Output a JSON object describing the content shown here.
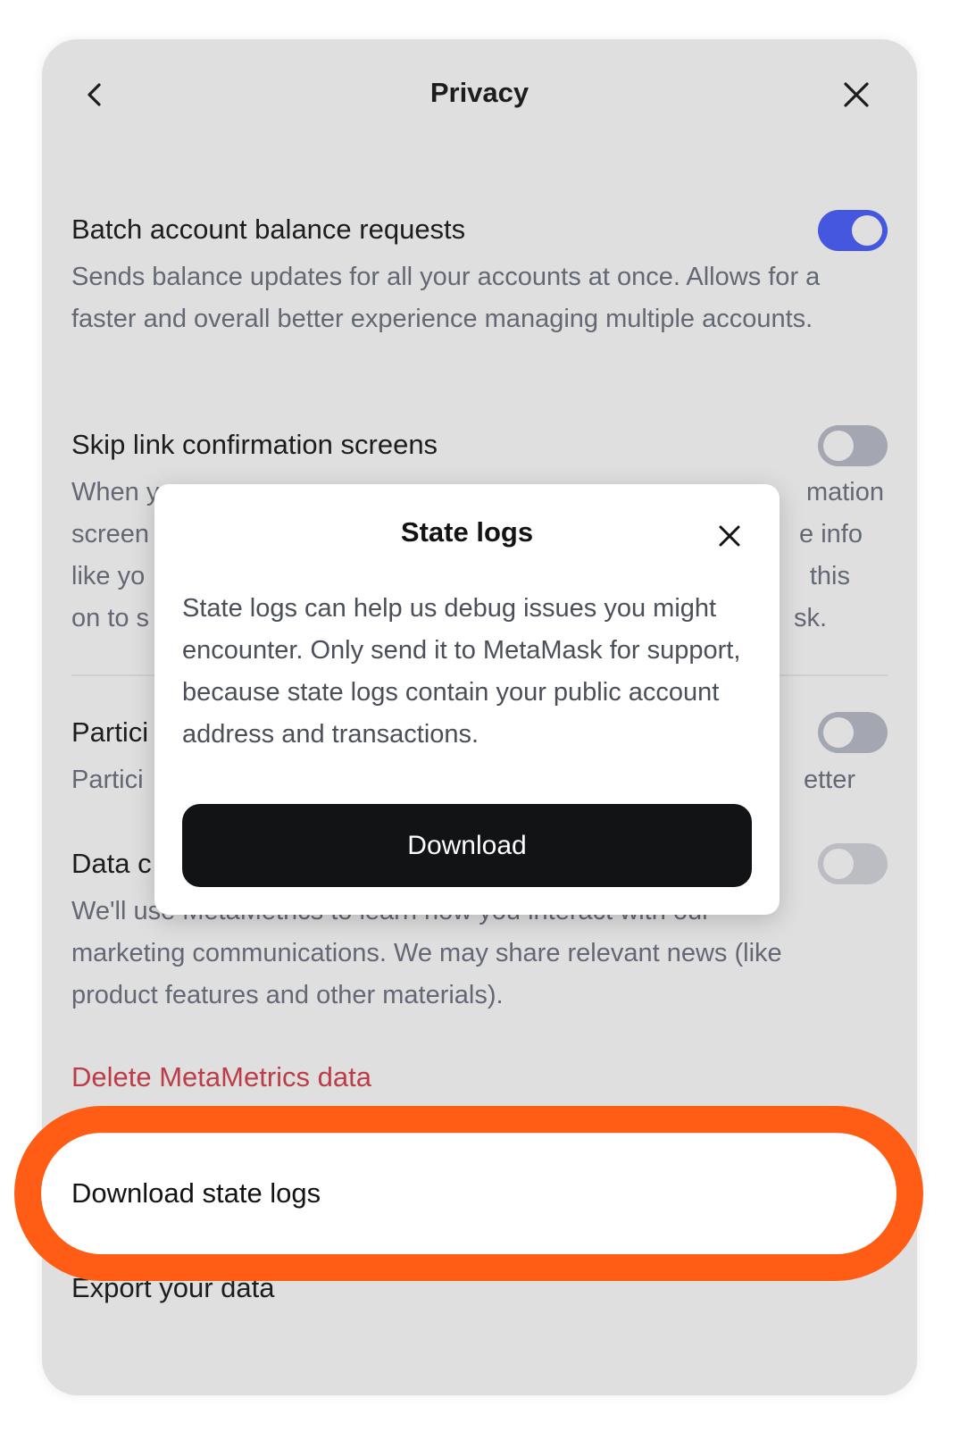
{
  "header": {
    "title": "Privacy",
    "back_icon": "chevron-left-icon",
    "close_icon": "close-icon"
  },
  "settings": [
    {
      "title": "Batch account balance requests",
      "description": "Sends balance updates for all your accounts at once. Allows for a faster and overall better experience managing multiple accounts.",
      "toggle": "on"
    },
    {
      "title": "Skip link confirmation screens",
      "description_visible_parts": [
        "When y",
        "mation",
        "screen",
        "e info",
        "like yo",
        "this",
        "on to s",
        "sk."
      ],
      "toggle": "off"
    },
    {
      "title_visible": "Partici",
      "description_visible_parts": [
        "Partici",
        "etter"
      ],
      "toggle": "off"
    },
    {
      "title_visible": "Data c",
      "description": "marketing communications. We may share relevant news (like product features and other materials).",
      "description_partial_line": "We'll use MetaMetrics to learn how you interact with our",
      "toggle": "off"
    }
  ],
  "links": {
    "delete_metametrics": "Delete MetaMetrics data",
    "download_state_logs": "Download state logs",
    "export_data": "Export your data"
  },
  "modal": {
    "title": "State logs",
    "body": "State logs can help us debug issues you might encounter. Only send it to MetaMask for support, because state logs contain your public account address and transactions.",
    "button_label": "Download",
    "close_icon": "close-icon"
  },
  "colors": {
    "accent_blue": "#4459ff",
    "danger_text": "#d73847",
    "highlight_orange": "#ff5c16",
    "button_dark": "#121314"
  }
}
